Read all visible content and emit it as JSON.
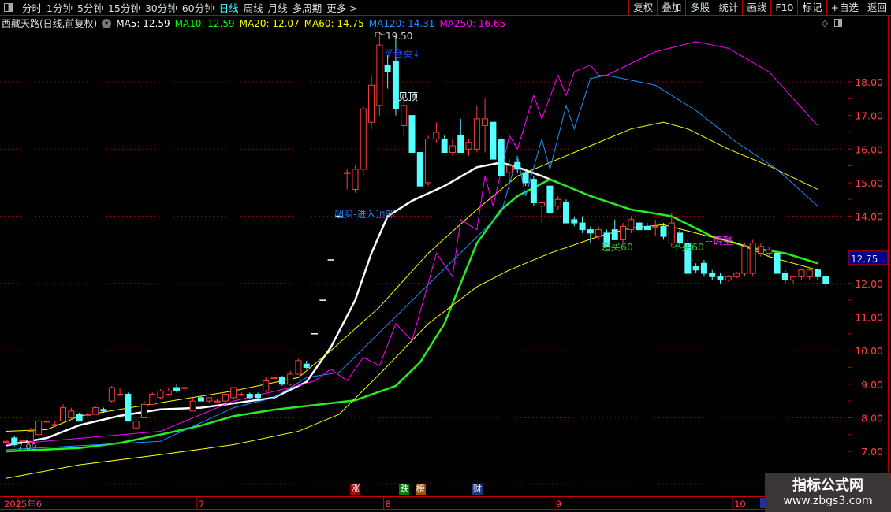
{
  "topbar": {
    "periods": [
      "分时",
      "1分钟",
      "5分钟",
      "15分钟",
      "30分钟",
      "60分钟",
      "日线",
      "周线",
      "月线",
      "多周期",
      "更多 >"
    ],
    "active": "日线",
    "right_menu": [
      "复权",
      "叠加",
      "多股",
      "统计",
      "画线",
      "F10",
      "标记",
      "+自选",
      "返回"
    ]
  },
  "info": {
    "title": "西藏天路(日线,前复权)",
    "ma": [
      {
        "label": "MA5: 12.59",
        "color": "#ffffff"
      },
      {
        "label": "MA10: 12.59",
        "color": "#00ff00"
      },
      {
        "label": "MA20: 12.07",
        "color": "#ffff00"
      },
      {
        "label": "MA60: 14.75",
        "color": "#ffff00"
      },
      {
        "label": "MA120: 14.31",
        "color": "#1e90ff"
      },
      {
        "label": "MA250: 16.65",
        "color": "#ff00ff"
      }
    ]
  },
  "current_price": "12.75",
  "annotations": {
    "high": "19.50",
    "low": "7.09",
    "sell": "平仓卖↓",
    "top": "见顶",
    "overbought": "超买-进入顶部",
    "ob60": "超买60",
    "nobuy60": "不买60",
    "adjust": "--调整"
  },
  "events": [
    {
      "label": "涨",
      "color": "#a00000",
      "idx": 43
    },
    {
      "label": "跌",
      "color": "#008000",
      "idx": 49
    },
    {
      "label": "榜",
      "color": "#a05000",
      "idx": 51
    },
    {
      "label": "财",
      "color": "#1a3a80",
      "idx": 58
    }
  ],
  "date_axis": [
    {
      "label": "2025年6",
      "idx": 0
    },
    {
      "label": "7",
      "idx": 24
    },
    {
      "label": "8",
      "idx": 47
    },
    {
      "label": "9",
      "idx": 68
    },
    {
      "label": "10",
      "idx": 90
    }
  ],
  "watermark": {
    "line1": "指标公式网",
    "line2": "www.zbgs3.com"
  },
  "chart_data": {
    "type": "candlestick",
    "yticks": [
      "18.00",
      "17.00",
      "16.00",
      "15.00",
      "14.00",
      "12.00",
      "11.00",
      "10.00",
      "9.00",
      "8.00",
      "7.00"
    ],
    "ylim": [
      5.9,
      20.0
    ],
    "candles_ohlc": [
      [
        7.3,
        7.35,
        7.25,
        7.3
      ],
      [
        7.4,
        7.45,
        7.15,
        7.2
      ],
      [
        7.3,
        7.35,
        7.28,
        7.32
      ],
      [
        7.3,
        7.7,
        7.25,
        7.6
      ],
      [
        7.5,
        7.95,
        7.45,
        7.9
      ],
      [
        7.9,
        8.0,
        7.85,
        7.9
      ],
      [
        7.8,
        7.9,
        7.75,
        7.8
      ],
      [
        7.9,
        8.4,
        7.9,
        8.3
      ],
      [
        8.0,
        8.3,
        7.95,
        8.2
      ],
      [
        8.1,
        8.15,
        7.9,
        7.9
      ],
      [
        8.1,
        8.15,
        8.05,
        8.1
      ],
      [
        8.1,
        8.35,
        8.1,
        8.3
      ],
      [
        8.25,
        8.3,
        8.15,
        8.2
      ],
      [
        8.5,
        8.95,
        8.45,
        8.9
      ],
      [
        8.7,
        8.9,
        8.65,
        8.7
      ],
      [
        8.7,
        8.75,
        7.9,
        7.9
      ],
      [
        7.7,
        8.0,
        7.65,
        7.9
      ],
      [
        8.0,
        8.5,
        8.0,
        8.4
      ],
      [
        8.4,
        8.75,
        8.4,
        8.7
      ],
      [
        8.6,
        8.85,
        8.55,
        8.8
      ],
      [
        8.7,
        8.9,
        8.65,
        8.8
      ],
      [
        8.9,
        9.0,
        8.75,
        8.8
      ],
      [
        8.9,
        9.0,
        8.8,
        8.9
      ],
      [
        8.2,
        8.6,
        8.2,
        8.5
      ],
      [
        8.6,
        8.65,
        8.5,
        8.5
      ],
      [
        8.5,
        8.6,
        8.45,
        8.6
      ],
      [
        8.5,
        8.55,
        8.45,
        8.5
      ],
      [
        8.5,
        8.7,
        8.45,
        8.7
      ],
      [
        8.6,
        8.9,
        8.55,
        8.9
      ],
      [
        8.7,
        8.75,
        8.65,
        8.7
      ],
      [
        8.7,
        8.75,
        8.55,
        8.6
      ],
      [
        8.7,
        8.75,
        8.55,
        8.6
      ],
      [
        8.8,
        9.2,
        8.75,
        9.1
      ],
      [
        9.2,
        9.4,
        9.0,
        9.2
      ],
      [
        9.2,
        9.25,
        8.95,
        9.0
      ],
      [
        9.0,
        9.4,
        8.95,
        9.3
      ],
      [
        9.3,
        9.75,
        9.3,
        9.7
      ],
      [
        9.6,
        9.7,
        9.45,
        9.5
      ],
      [
        10.5,
        10.5,
        10.5,
        10.5
      ],
      [
        11.5,
        11.5,
        11.5,
        11.5
      ],
      [
        12.7,
        12.7,
        12.7,
        12.7
      ],
      [
        14.0,
        14.0,
        14.0,
        14.0
      ],
      [
        15.3,
        15.4,
        14.8,
        15.3
      ],
      [
        14.8,
        15.5,
        14.7,
        15.4
      ],
      [
        15.4,
        17.3,
        15.2,
        17.2
      ],
      [
        16.8,
        18.2,
        16.6,
        17.9
      ],
      [
        17.3,
        19.5,
        17.0,
        19.1
      ],
      [
        18.5,
        18.8,
        17.8,
        18.3
      ],
      [
        18.6,
        19.4,
        17.0,
        17.2
      ],
      [
        16.7,
        17.5,
        16.4,
        17.3
      ],
      [
        17.0,
        17.0,
        15.9,
        15.9
      ],
      [
        15.9,
        15.9,
        14.9,
        14.9
      ],
      [
        15.0,
        16.4,
        14.9,
        16.3
      ],
      [
        16.3,
        16.8,
        16.2,
        16.5
      ],
      [
        16.3,
        16.4,
        15.9,
        15.9
      ],
      [
        15.9,
        16.3,
        15.8,
        16.1
      ],
      [
        16.4,
        16.9,
        15.9,
        15.9
      ],
      [
        16.0,
        16.3,
        15.8,
        16.2
      ],
      [
        16.0,
        17.3,
        15.9,
        16.9
      ],
      [
        16.7,
        17.5,
        15.9,
        16.9
      ],
      [
        16.8,
        16.8,
        15.7,
        15.7
      ],
      [
        16.3,
        16.4,
        15.2,
        15.2
      ],
      [
        15.3,
        15.7,
        15.0,
        15.5
      ],
      [
        15.6,
        15.7,
        15.3,
        15.4
      ],
      [
        15.3,
        15.4,
        14.9,
        15.0
      ],
      [
        15.1,
        15.2,
        14.3,
        14.4
      ],
      [
        14.3,
        14.4,
        13.8,
        14.4
      ],
      [
        14.9,
        15.1,
        14.1,
        14.1
      ],
      [
        14.3,
        14.6,
        14.2,
        14.5
      ],
      [
        14.4,
        14.5,
        13.8,
        13.8
      ],
      [
        13.9,
        14.0,
        13.7,
        13.8
      ],
      [
        13.8,
        14.0,
        13.5,
        13.6
      ],
      [
        13.6,
        13.7,
        13.2,
        13.5
      ],
      [
        13.4,
        13.7,
        13.3,
        13.6
      ],
      [
        13.5,
        13.6,
        13.1,
        13.1
      ],
      [
        13.6,
        13.9,
        13.3,
        13.3
      ],
      [
        13.3,
        13.8,
        13.2,
        13.7
      ],
      [
        13.6,
        14.0,
        13.5,
        13.9
      ],
      [
        13.8,
        13.9,
        13.6,
        13.6
      ],
      [
        13.7,
        13.8,
        13.6,
        13.6
      ],
      [
        13.7,
        13.9,
        13.4,
        13.7
      ],
      [
        13.7,
        13.8,
        13.3,
        13.4
      ],
      [
        13.2,
        14.1,
        13.1,
        13.8
      ],
      [
        13.5,
        13.6,
        13.1,
        13.2
      ],
      [
        13.2,
        13.3,
        12.3,
        12.3
      ],
      [
        12.5,
        12.6,
        12.3,
        12.4
      ],
      [
        12.6,
        12.7,
        12.2,
        12.3
      ],
      [
        12.3,
        12.4,
        12.1,
        12.2
      ],
      [
        12.2,
        12.3,
        12.0,
        12.1
      ],
      [
        12.1,
        12.25,
        12.05,
        12.2
      ],
      [
        12.2,
        12.35,
        12.15,
        12.3
      ],
      [
        12.3,
        13.2,
        12.2,
        13.1
      ],
      [
        12.3,
        13.3,
        12.2,
        13.2
      ],
      [
        12.9,
        13.2,
        12.8,
        13.1
      ],
      [
        12.9,
        13.1,
        12.8,
        13.0
      ],
      [
        12.9,
        13.0,
        12.2,
        12.3
      ],
      [
        12.3,
        12.4,
        12.0,
        12.1
      ],
      [
        12.1,
        12.2,
        12.0,
        12.2
      ],
      [
        12.2,
        12.45,
        12.1,
        12.4
      ],
      [
        12.2,
        12.5,
        12.1,
        12.4
      ],
      [
        12.4,
        12.45,
        12.1,
        12.2
      ],
      [
        12.2,
        12.25,
        11.9,
        12.0
      ]
    ],
    "lines": [
      {
        "name": "white-line",
        "color": "#ffffff",
        "width": 2.5,
        "points": [
          [
            0,
            7.18
          ],
          [
            5,
            7.4
          ],
          [
            9,
            7.78
          ],
          [
            14,
            8.06
          ],
          [
            19,
            8.25
          ],
          [
            24,
            8.3
          ],
          [
            28,
            8.43
          ],
          [
            33,
            8.6
          ],
          [
            37,
            9.07
          ],
          [
            40,
            10.1
          ],
          [
            43,
            11.5
          ],
          [
            45,
            12.9
          ],
          [
            47,
            14.0
          ],
          [
            50,
            14.46
          ],
          [
            54,
            14.9
          ],
          [
            58,
            15.46
          ],
          [
            61,
            15.6
          ],
          [
            63,
            15.46
          ],
          [
            66,
            15.2
          ],
          [
            68,
            15.0
          ]
        ]
      },
      {
        "name": "ma10-line",
        "color": "#22ee22",
        "width": 2.5,
        "points": [
          [
            0,
            7.0
          ],
          [
            9,
            7.1
          ],
          [
            14,
            7.25
          ],
          [
            19,
            7.5
          ],
          [
            24,
            7.77
          ],
          [
            28,
            8.05
          ],
          [
            33,
            8.24
          ],
          [
            38,
            8.38
          ],
          [
            43,
            8.52
          ],
          [
            48,
            8.95
          ],
          [
            51,
            9.65
          ],
          [
            54,
            10.8
          ],
          [
            58,
            13.2
          ],
          [
            61,
            14.2
          ],
          [
            63,
            14.6
          ],
          [
            67,
            15.1
          ],
          [
            72,
            14.6
          ],
          [
            77,
            14.2
          ],
          [
            82,
            14.0
          ],
          [
            87,
            13.4
          ],
          [
            92,
            13.05
          ],
          [
            96,
            12.9
          ],
          [
            100,
            12.6
          ]
        ]
      },
      {
        "name": "ma60-line",
        "color": "#ffff00",
        "width": 1,
        "points": [
          [
            0,
            7.6
          ],
          [
            5,
            7.65
          ],
          [
            9,
            8.05
          ],
          [
            19,
            8.45
          ],
          [
            28,
            8.8
          ],
          [
            36,
            9.2
          ],
          [
            40,
            10.0
          ],
          [
            46,
            11.3
          ],
          [
            52,
            12.9
          ],
          [
            58,
            14.2
          ],
          [
            63,
            15.2
          ],
          [
            67,
            15.6
          ],
          [
            72,
            16.1
          ],
          [
            77,
            16.6
          ],
          [
            81,
            16.8
          ],
          [
            84,
            16.6
          ],
          [
            89,
            16.0
          ],
          [
            94,
            15.5
          ],
          [
            100,
            14.8
          ]
        ]
      },
      {
        "name": "ma20-line",
        "color": "#ffff00",
        "width": 1,
        "points": [
          [
            0,
            6.2
          ],
          [
            9,
            6.6
          ],
          [
            19,
            6.9
          ],
          [
            28,
            7.2
          ],
          [
            36,
            7.6
          ],
          [
            41,
            8.1
          ],
          [
            46,
            9.3
          ],
          [
            52,
            10.8
          ],
          [
            58,
            11.9
          ],
          [
            62,
            12.4
          ],
          [
            67,
            12.9
          ],
          [
            73,
            13.4
          ],
          [
            77,
            13.65
          ],
          [
            81,
            13.75
          ],
          [
            85,
            13.5
          ],
          [
            90,
            13.2
          ],
          [
            94,
            12.8
          ],
          [
            100,
            12.4
          ]
        ]
      },
      {
        "name": "ma120-line",
        "color": "#1e90ff",
        "width": 1,
        "points": [
          [
            0,
            7.05
          ],
          [
            19,
            7.3
          ],
          [
            28,
            8.3
          ],
          [
            33,
            8.6
          ],
          [
            37,
            9.2
          ],
          [
            41,
            9.35
          ],
          [
            61,
            14.1
          ],
          [
            63,
            15.8
          ],
          [
            64,
            14.6
          ],
          [
            66,
            16.3
          ],
          [
            67,
            15.4
          ],
          [
            69,
            17.3
          ],
          [
            70,
            16.6
          ],
          [
            72,
            18.1
          ],
          [
            74,
            18.2
          ],
          [
            80,
            17.9
          ],
          [
            85,
            17.15
          ],
          [
            90,
            16.2
          ],
          [
            95,
            15.4
          ],
          [
            100,
            14.3
          ]
        ]
      },
      {
        "name": "ma250-line",
        "color": "#ff00ff",
        "width": 1,
        "points": [
          [
            0,
            7.2
          ],
          [
            19,
            7.6
          ],
          [
            28,
            8.5
          ],
          [
            35,
            8.9
          ],
          [
            38,
            9.1
          ],
          [
            40,
            9.45
          ],
          [
            42,
            9.1
          ],
          [
            44,
            9.8
          ],
          [
            46,
            9.55
          ],
          [
            48,
            10.8
          ],
          [
            50,
            10.3
          ],
          [
            52,
            12.0
          ],
          [
            53,
            12.9
          ],
          [
            55,
            12.2
          ],
          [
            56,
            13.9
          ],
          [
            58,
            13.6
          ],
          [
            59,
            15.2
          ],
          [
            60,
            14.3
          ],
          [
            62,
            16.4
          ],
          [
            63,
            16.0
          ],
          [
            65,
            17.6
          ],
          [
            66,
            16.9
          ],
          [
            68,
            18.2
          ],
          [
            69,
            17.6
          ],
          [
            70,
            18.3
          ],
          [
            72,
            18.5
          ],
          [
            73,
            18.2
          ],
          [
            74,
            18.2
          ],
          [
            80,
            18.9
          ],
          [
            85,
            19.2
          ],
          [
            89,
            19.0
          ],
          [
            94,
            18.3
          ],
          [
            100,
            16.7
          ]
        ]
      }
    ]
  }
}
